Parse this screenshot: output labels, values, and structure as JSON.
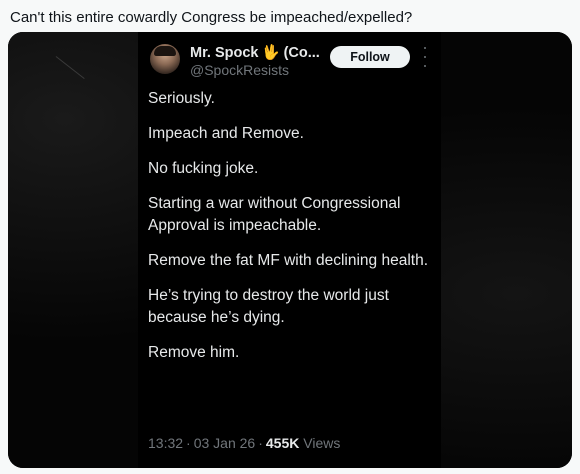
{
  "post": {
    "text": "Can't this entire cowardly Congress be impeached/expelled?"
  },
  "embedded_tweet": {
    "author_name": "Mr. Spock",
    "author_name_suffix": "(Co...",
    "verified_icon": "vulcan-salute-hand-icon",
    "handle": "@SpockResists",
    "follow_label": "Follow",
    "body": [
      "Seriously.",
      "Impeach and Remove.",
      "No fucking joke.",
      "Starting a war without Congressional Approval is impeachable.",
      "Remove the fat MF with declining health.",
      "He’s trying to destroy the world just because he’s dying.",
      "Remove him."
    ],
    "time": "13:32",
    "date": "03 Jan 26",
    "views_count": "455K",
    "views_label": "Views"
  }
}
